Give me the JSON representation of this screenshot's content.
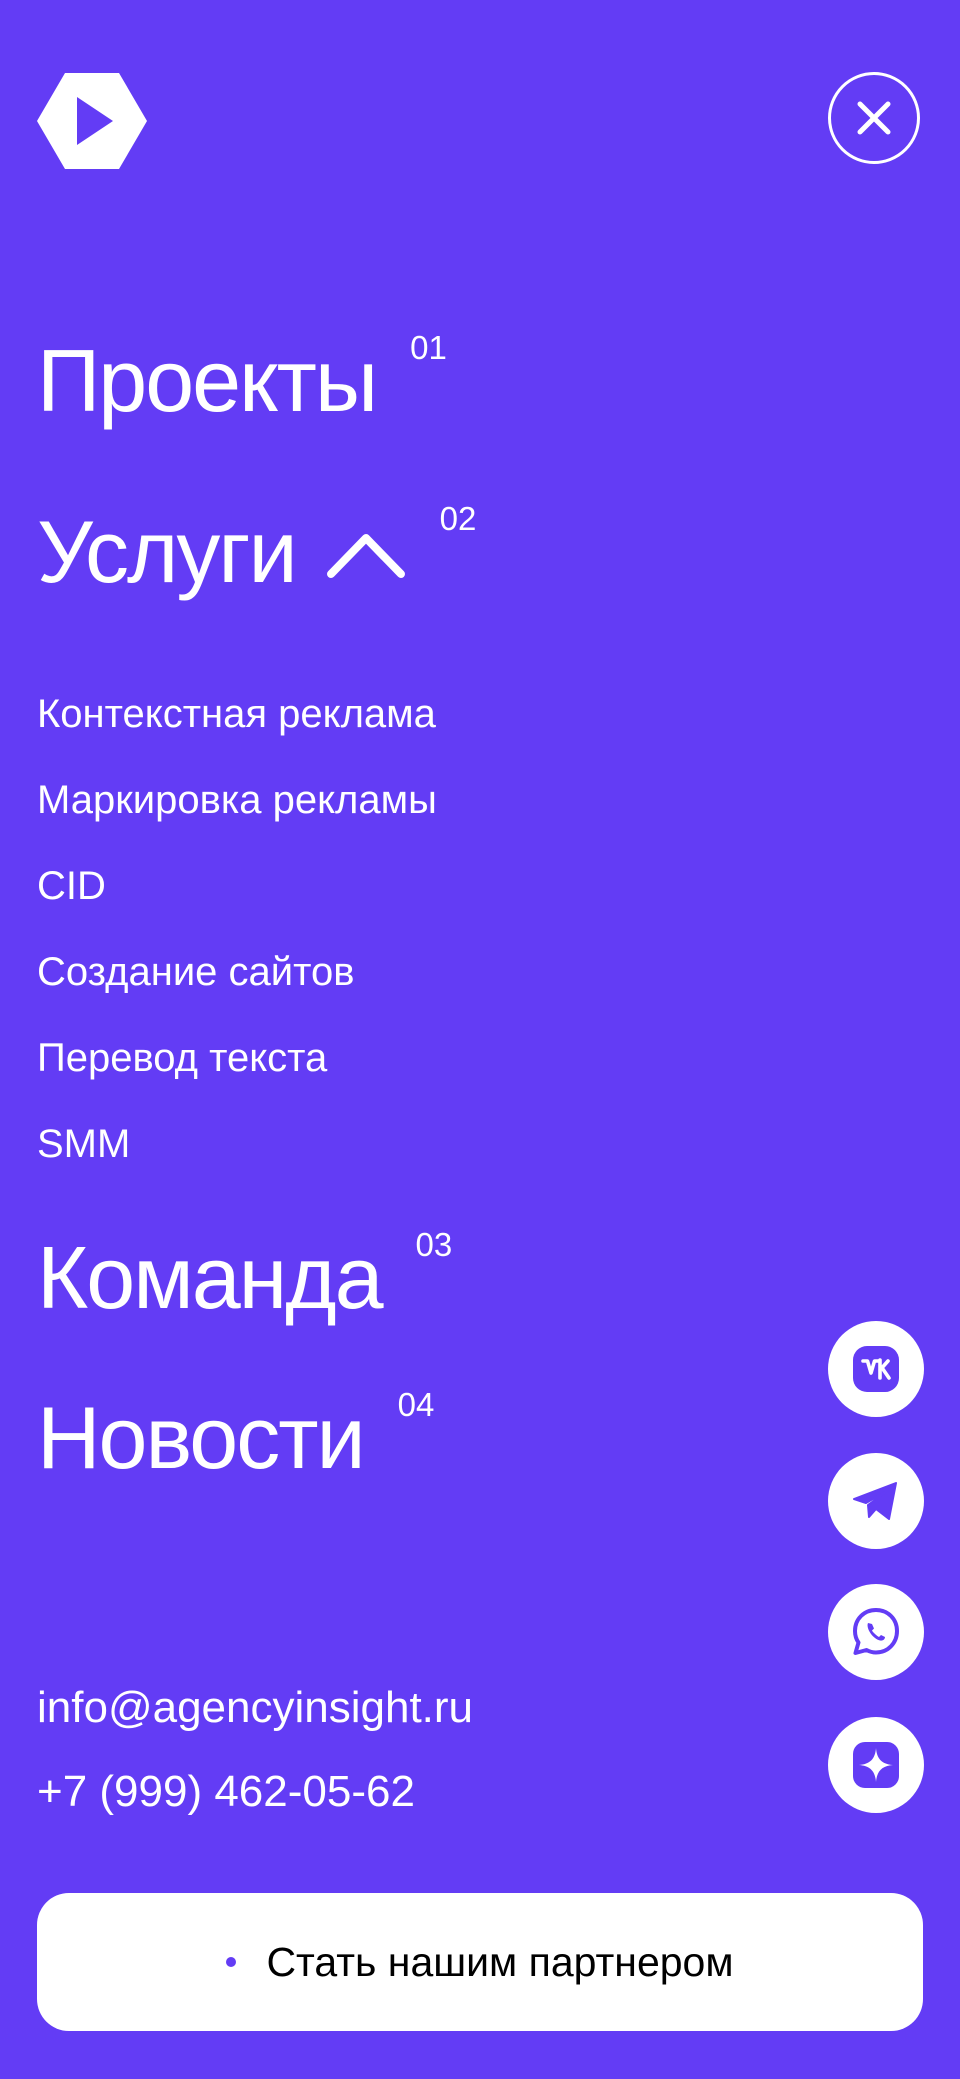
{
  "colors": {
    "background": "#633cf5",
    "foreground": "#ffffff",
    "cta_text": "#000000"
  },
  "header": {
    "logo_icon": "hexagon-arrow-logo",
    "close_icon": "close-icon"
  },
  "nav": [
    {
      "label": "Проекты",
      "num": "01"
    },
    {
      "label": "Услуги",
      "num": "02",
      "expanded": true
    },
    {
      "label": "Команда",
      "num": "03"
    },
    {
      "label": "Новости",
      "num": "04"
    }
  ],
  "services": [
    "Контекстная реклама",
    "Маркировка рекламы",
    "CID",
    "Создание сайтов",
    "Перевод текста",
    "SMM"
  ],
  "contacts": {
    "email": "info@agencyinsight.ru",
    "phone": "+7 (999) 462-05-62"
  },
  "social": [
    "vk-icon",
    "telegram-icon",
    "whatsapp-icon",
    "zen-icon"
  ],
  "cta": {
    "label": "Стать нашим партнером"
  }
}
